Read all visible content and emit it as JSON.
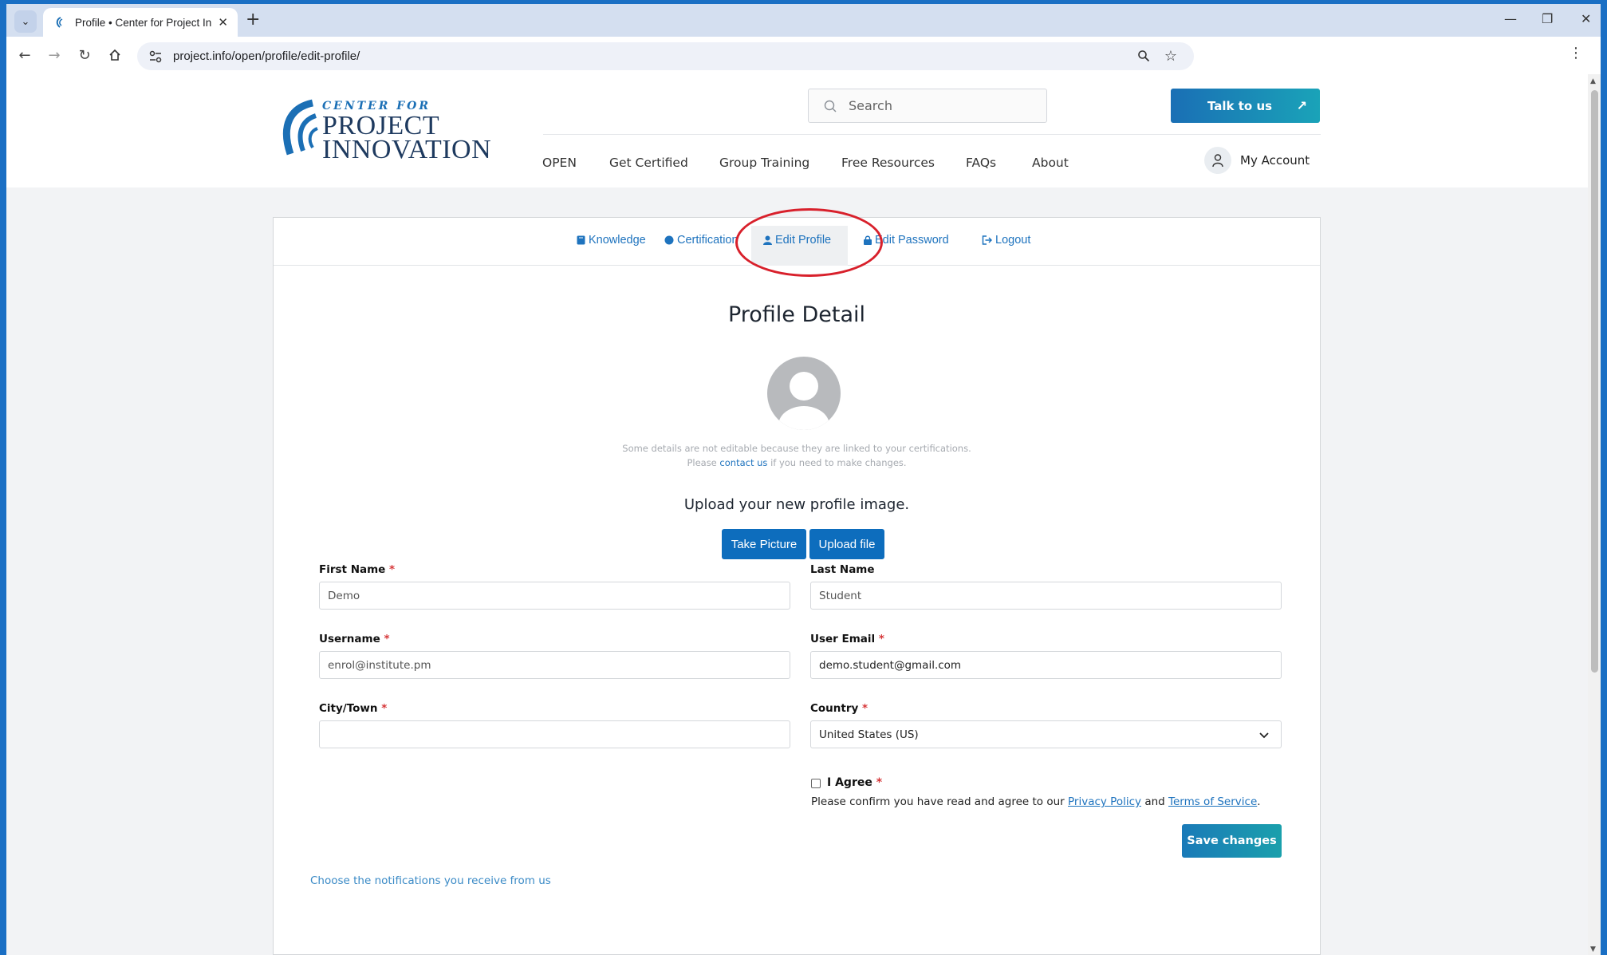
{
  "browser": {
    "tab_title": "Profile • Center for Project Inno",
    "url": "project.info/open/profile/edit-profile/",
    "icons": [
      "tab-search-icon",
      "favicon",
      "close-icon",
      "new-tab-icon",
      "minimize-icon",
      "restore-icon",
      "window-close-icon",
      "back-icon",
      "forward-icon",
      "reload-icon",
      "home-icon",
      "site-info-icon",
      "zoom-icon",
      "bookmark-star-icon",
      "kebab-menu-icon"
    ]
  },
  "header": {
    "logo": {
      "small": "CENTER FOR",
      "line1": "PROJECT",
      "line2": "INNOVATION"
    },
    "search_placeholder": "Search",
    "talk_label": "Talk to us",
    "nav": [
      "OPEN",
      "Get Certified",
      "Group Training",
      "Free Resources",
      "FAQs",
      "About"
    ],
    "account_label": "My Account"
  },
  "profile_tabs": [
    "Knowledge",
    "Certification",
    "Edit Profile",
    "Edit Password",
    "Logout"
  ],
  "active_tab": "Edit Profile",
  "main": {
    "title": "Profile Detail",
    "note_line1": "Some details are not editable because they are linked to your certifications.",
    "note_please": "Please",
    "note_link": "contact us",
    "note_rest": "if you need to make changes.",
    "upload_title": "Upload your new profile image.",
    "take_picture": "Take Picture",
    "upload_file": "Upload file"
  },
  "form": {
    "first_name": {
      "label": "First Name",
      "required": "*",
      "value": "Demo"
    },
    "last_name": {
      "label": "Last Name",
      "value": "Student"
    },
    "username": {
      "label": "Username",
      "required": "*",
      "value": "enrol@institute.pm"
    },
    "email": {
      "label": "User Email",
      "required": "*",
      "value": "demo.student@gmail.com"
    },
    "city": {
      "label": "City/Town",
      "required": "*",
      "value": ""
    },
    "country": {
      "label": "Country",
      "required": "*",
      "value": "United States (US)"
    },
    "agree": {
      "label": "I Agree",
      "required": "*",
      "text_before": "Please confirm you have read and agree to our",
      "privacy": "Privacy Policy",
      "and": "and",
      "terms": "Terms of Service",
      "end": "."
    },
    "save_label": "Save changes",
    "notifications_link": "Choose the notifications you receive from us"
  },
  "colors": {
    "accent": "#1e73be",
    "button": "#0d6dbd",
    "annotation": "#d8202b"
  }
}
